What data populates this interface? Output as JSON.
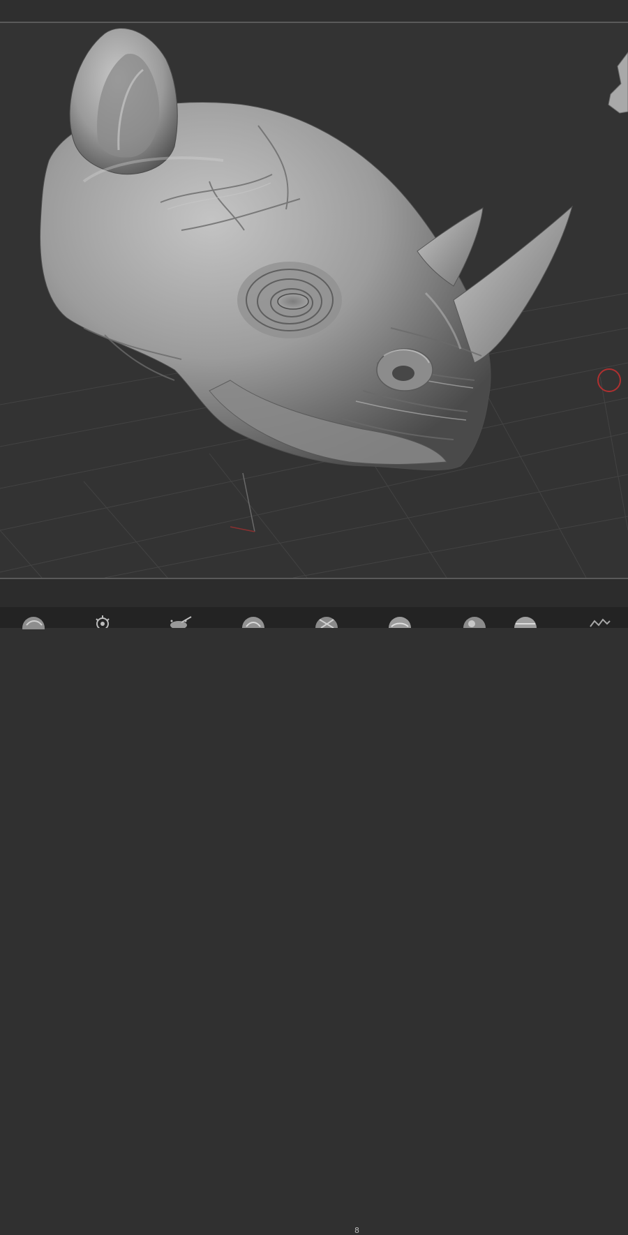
{
  "viewport": {
    "model": "rhino-head-sculpt",
    "colors": {
      "background": "#333333",
      "model_gray": "#9a9a9a",
      "grid": "#4a4a4a",
      "cursor_ring": "#b03030"
    }
  },
  "bottom_shelf": {
    "brushes": [
      {
        "icon": "clay-brush-icon"
      },
      {
        "icon": "settings-gear-icon"
      },
      {
        "icon": "spray-brush-icon"
      },
      {
        "icon": "standard-brush-icon"
      },
      {
        "icon": "dam-standard-brush-icon"
      },
      {
        "icon": "smooth-brush-icon"
      },
      {
        "icon": "inflate-brush-icon"
      },
      {
        "icon": "flatten-brush-icon"
      },
      {
        "icon": "crease-brush-icon"
      }
    ],
    "brush_count_label": "8"
  }
}
